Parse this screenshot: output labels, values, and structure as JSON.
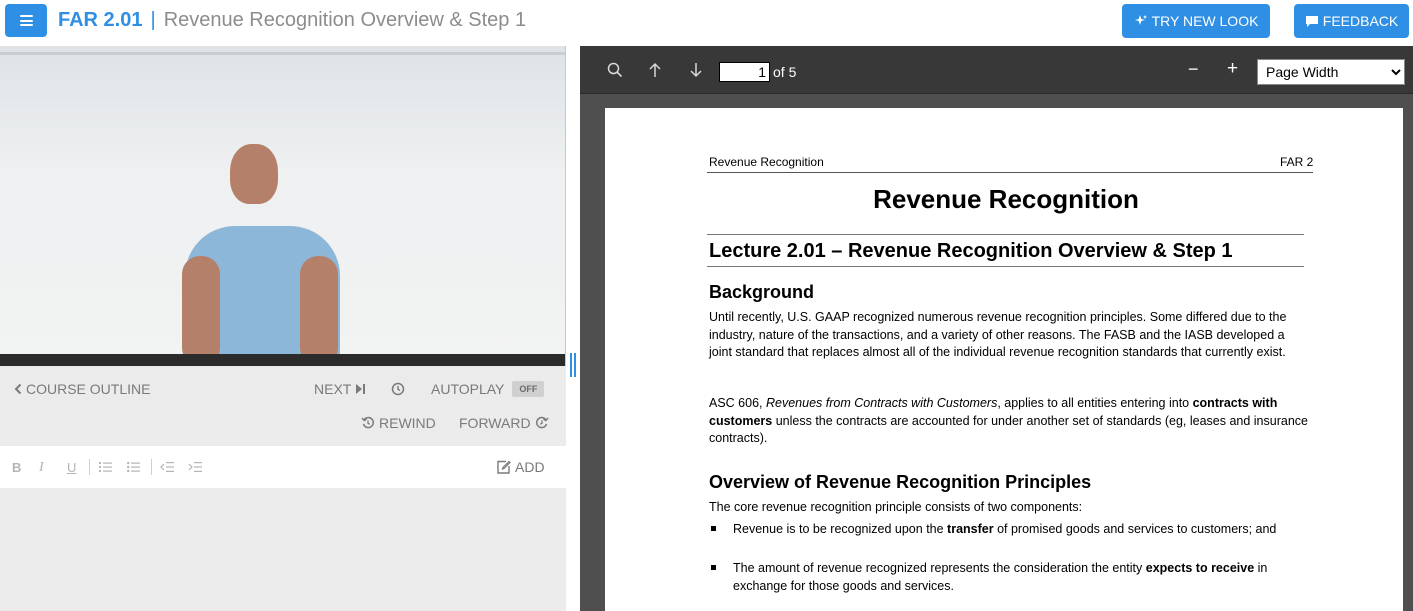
{
  "header": {
    "menu_icon": "hamburger-icon",
    "course_code": "FAR 2.01",
    "separator": "|",
    "lesson_title": "Revenue Recognition Overview & Step 1",
    "try_new_look_label": "TRY NEW LOOK",
    "feedback_label": "FEEDBACK",
    "accent_color": "#2f8fe4"
  },
  "player": {
    "course_outline_label": "COURSE OUTLINE",
    "next_label": "NEXT",
    "autoplay_label": "AUTOPLAY",
    "autoplay_state": "OFF",
    "rewind_label": "REWIND",
    "forward_label": "FORWARD"
  },
  "notes": {
    "bold_label": "B",
    "italic_label": "I",
    "underline_label": "U",
    "add_label": "ADD"
  },
  "pdf_viewer": {
    "current_page": "1",
    "page_count_text": "of 5",
    "zoom_minus": "−",
    "zoom_plus": "+",
    "zoom_mode": "Page Width"
  },
  "document": {
    "running_header_left": "Revenue Recognition",
    "running_header_right": "FAR 2",
    "title": "Revenue Recognition",
    "lecture_title": "Lecture 2.01 – Revenue Recognition Overview & Step 1",
    "background_heading": "Background",
    "background_text": "Until recently, U.S. GAAP recognized numerous revenue recognition principles.  Some differed due to the industry, nature of the transactions, and a variety of other reasons.  The FASB and the IASB developed a joint standard that replaces almost all of the individual revenue recognition standards that currently exist.",
    "asc_prefix": "ASC 606, ",
    "asc_italic": "Revenues from Contracts with Customers",
    "asc_middle": ", applies to all entities entering into ",
    "asc_bold": "contracts with customers",
    "asc_suffix": " unless the contracts are accounted for under another set of standards (eg, leases and insurance contracts).",
    "overview_heading": "Overview of Revenue Recognition Principles",
    "overview_intro": "The core revenue recognition principle consists of two components:",
    "bullet1_prefix": "Revenue is to be recognized upon the ",
    "bullet1_bold": "transfer",
    "bullet1_suffix": " of promised goods and services to customers; and",
    "bullet2_prefix": "The amount of revenue recognized represents the consideration the entity ",
    "bullet2_bold": "expects to receive",
    "bullet2_suffix": " in exchange for those goods and services."
  }
}
